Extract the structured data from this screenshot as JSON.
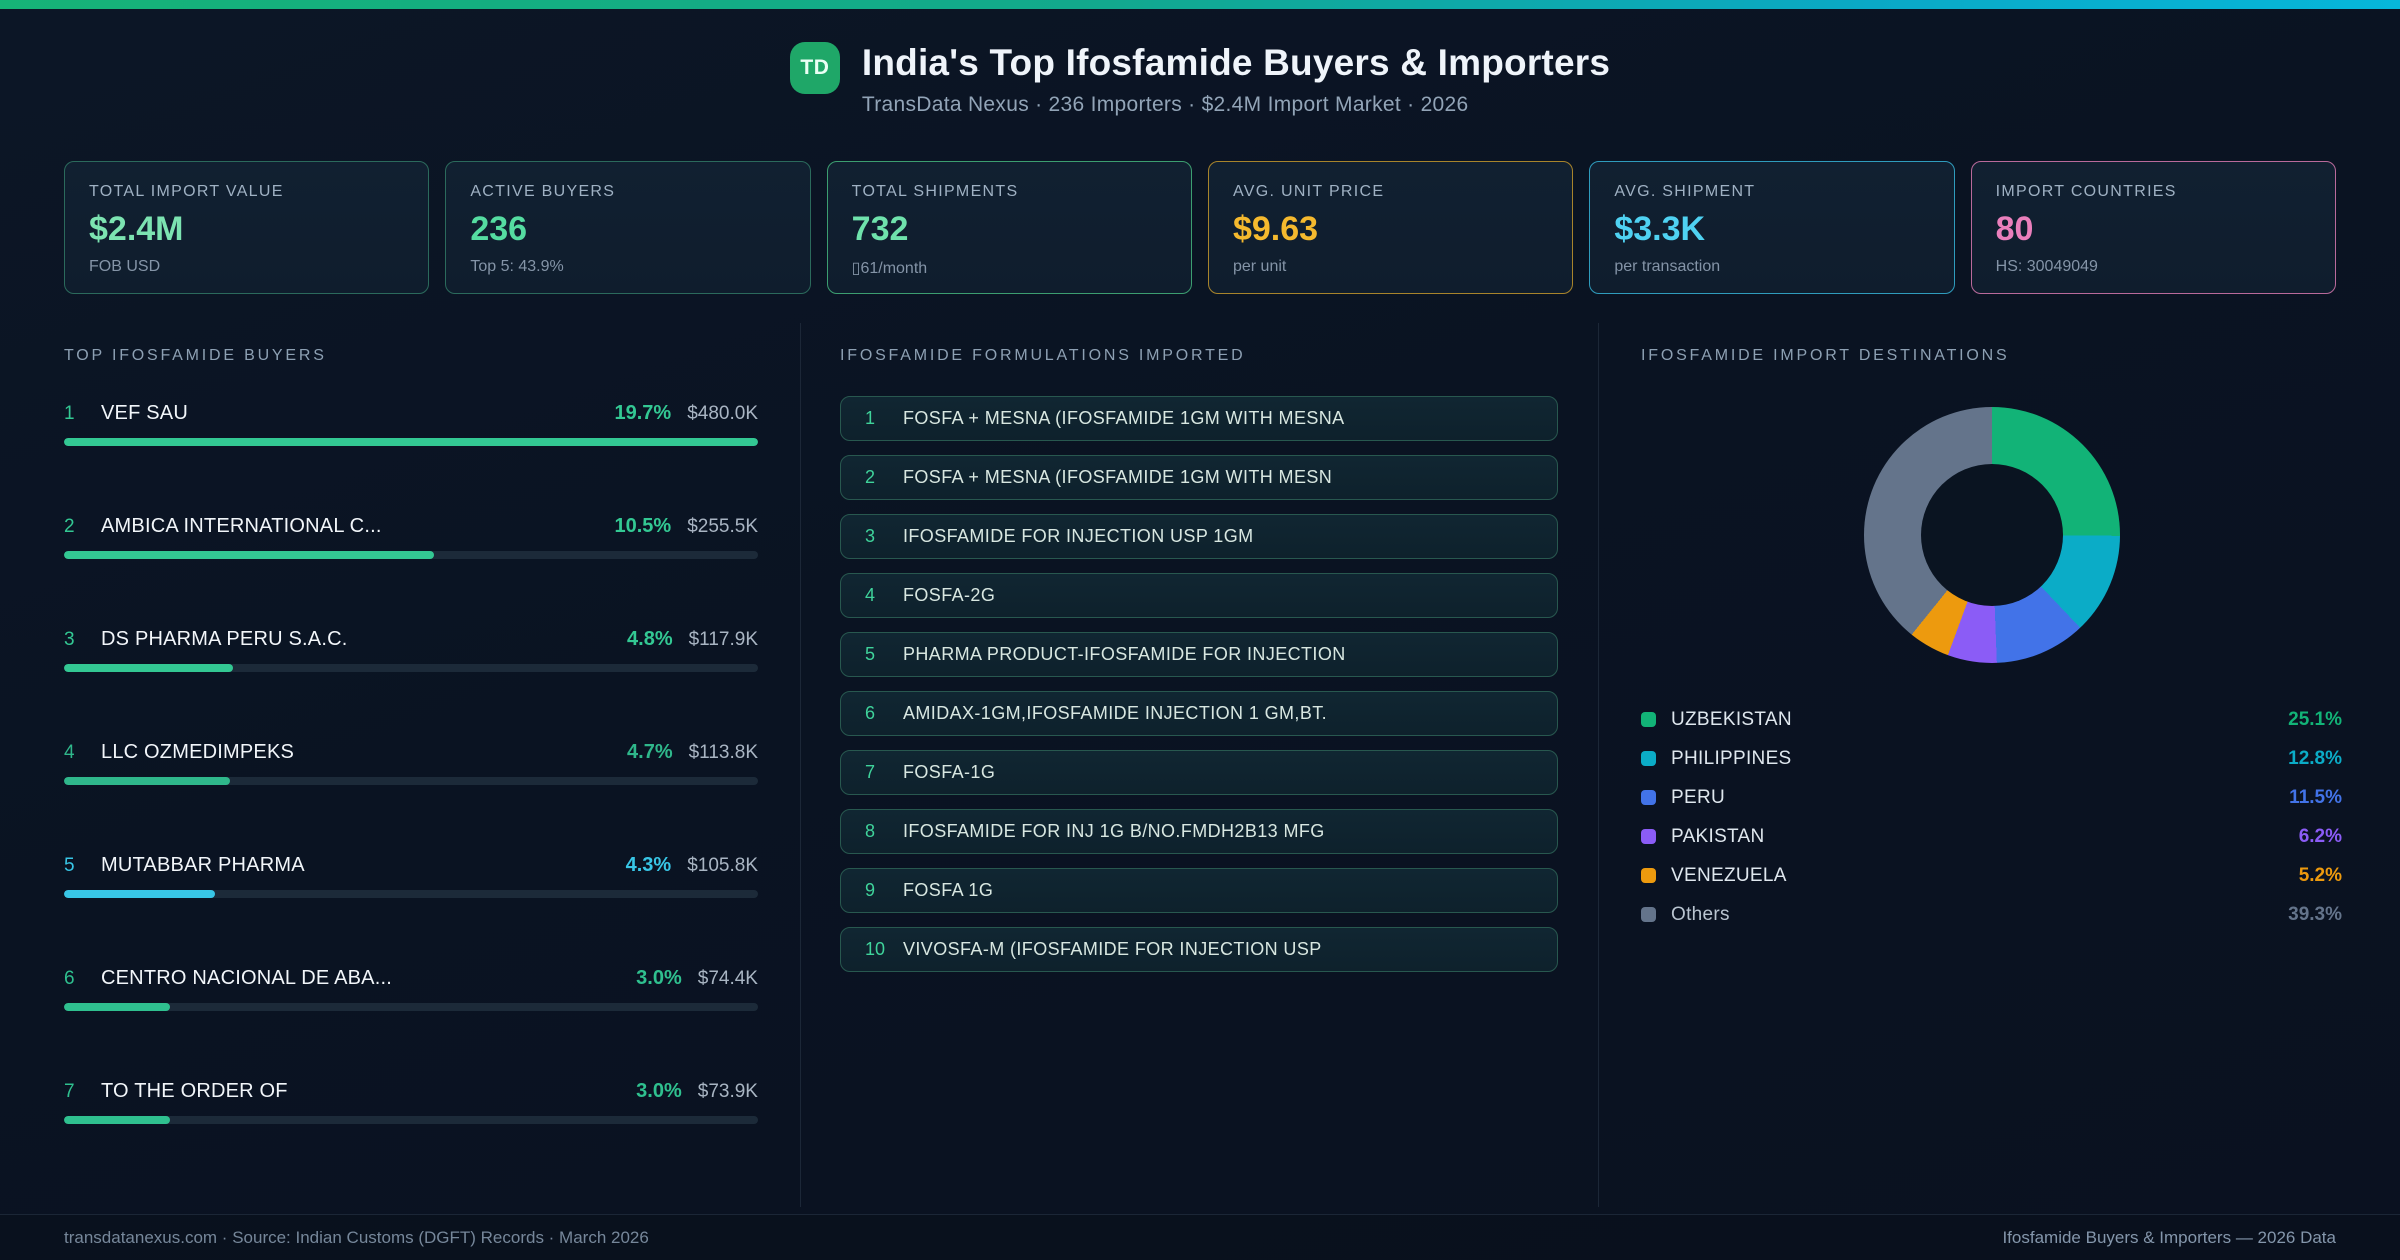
{
  "header": {
    "badge": "TD",
    "title": "India's Top Ifosfamide Buyers & Importers",
    "subtitle": "TransData Nexus · 236 Importers · $2.4M Import Market · 2026"
  },
  "stats": {
    "cards": [
      {
        "label": "TOTAL IMPORT VALUE",
        "value": "$2.4M",
        "sub": "FOB USD",
        "border_color": "#2b6a5c",
        "value_color": "#7ce3b1"
      },
      {
        "label": "ACTIVE BUYERS",
        "value": "236",
        "sub": "Top 5: 43.9%",
        "border_color": "#2b6a5c",
        "value_color": "#55dca1"
      },
      {
        "label": "TOTAL SHIPMENTS",
        "value": "732",
        "sub": "▯61/month",
        "border_color": "#3c9e70",
        "value_color": "#6fe2ac"
      },
      {
        "label": "AVG. UNIT PRICE",
        "value": "$9.63",
        "sub": "per unit",
        "border_color": "#a8842b",
        "value_color": "#f5b92e"
      },
      {
        "label": "AVG. SHIPMENT",
        "value": "$3.3K",
        "sub": "per transaction",
        "border_color": "#2f9cbd",
        "value_color": "#4fd2f2"
      },
      {
        "label": "IMPORT COUNTRIES",
        "value": "80",
        "sub": "HS: 30049049",
        "border_color": "#b96a9b",
        "value_color": "#ea7fbc"
      }
    ]
  },
  "buyers": {
    "title": "TOP IFOSFAMIDE BUYERS",
    "rows": [
      {
        "rank": "1",
        "name": "VEF SAU",
        "pct": "19.7%",
        "share": 19.7,
        "value": "$480.0K",
        "color": "#33c893"
      },
      {
        "rank": "2",
        "name": "AMBICA INTERNATIONAL C...",
        "pct": "10.5%",
        "share": 10.5,
        "value": "$255.5K",
        "color": "#33c893"
      },
      {
        "rank": "3",
        "name": "DS PHARMA PERU S.A.C.",
        "pct": "4.8%",
        "share": 4.8,
        "value": "$117.9K",
        "color": "#33c893"
      },
      {
        "rank": "4",
        "name": "LLC OZMEDIMPEKS",
        "pct": "4.7%",
        "share": 4.7,
        "value": "$113.8K",
        "color": "#2fb78b"
      },
      {
        "rank": "5",
        "name": "MUTABBAR PHARMA",
        "pct": "4.3%",
        "share": 4.3,
        "value": "$105.8K",
        "color": "#38c6e6"
      },
      {
        "rank": "6",
        "name": "CENTRO NACIONAL DE ABA...",
        "pct": "3.0%",
        "share": 3.0,
        "value": "$74.4K",
        "color": "#2fc08f"
      },
      {
        "rank": "7",
        "name": "TO THE ORDER OF",
        "pct": "3.0%",
        "share": 3.0,
        "value": "$73.9K",
        "color": "#2fc08f"
      }
    ]
  },
  "formulations": {
    "title": "IFOSFAMIDE FORMULATIONS IMPORTED",
    "items": [
      {
        "num": "1",
        "text": "FOSFA + MESNA (IFOSFAMIDE 1GM WITH MESNA"
      },
      {
        "num": "2",
        "text": "FOSFA + MESNA (IFOSFAMIDE 1GM WITH MESN"
      },
      {
        "num": "3",
        "text": "IFOSFAMIDE FOR INJECTION USP 1GM"
      },
      {
        "num": "4",
        "text": "FOSFA-2G"
      },
      {
        "num": "5",
        "text": "PHARMA PRODUCT-IFOSFAMIDE FOR INJECTION"
      },
      {
        "num": "6",
        "text": "AMIDAX-1GM,IFOSFAMIDE INJECTION 1 GM,BT."
      },
      {
        "num": "7",
        "text": "FOSFA-1G"
      },
      {
        "num": "8",
        "text": "IFOSFAMIDE FOR INJ 1G B/NO.FMDH2B13 MFG"
      },
      {
        "num": "9",
        "text": "FOSFA 1G"
      },
      {
        "num": "10",
        "text": "VIVOSFA-M (IFOSFAMIDE FOR INJECTION USP"
      }
    ]
  },
  "destinations": {
    "title": "IFOSFAMIDE IMPORT DESTINATIONS"
  },
  "chart_data": [
    {
      "type": "pie",
      "subtype": "donut",
      "title": "IFOSFAMIDE IMPORT DESTINATIONS",
      "start_angle_deg": 0,
      "direction": "clockwise",
      "inner_radius_ratio": 0.55,
      "legend_position": "below",
      "segments": [
        {
          "label": "UZBEKISTAN",
          "value": 25.1,
          "display": "25.1%",
          "color": "#12b377"
        },
        {
          "label": "PHILIPPINES",
          "value": 12.8,
          "display": "12.8%",
          "color": "#0bacc7"
        },
        {
          "label": "PERU",
          "value": 11.5,
          "display": "11.5%",
          "color": "#4273e8"
        },
        {
          "label": "PAKISTAN",
          "value": 6.2,
          "display": "6.2%",
          "color": "#8b5cf6"
        },
        {
          "label": "VENEZUELA",
          "value": 5.2,
          "display": "5.2%",
          "color": "#ed9a0e"
        },
        {
          "label": "Others",
          "value": 39.3,
          "display": "39.3%",
          "color": "#64748b"
        }
      ]
    },
    {
      "type": "bar",
      "title": "TOP IFOSFAMIDE BUYERS",
      "orientation": "horizontal",
      "categories": [
        "VEF SAU",
        "AMBICA INTERNATIONAL C...",
        "DS PHARMA PERU S.A.C.",
        "LLC OZMEDIMPEKS",
        "MUTABBAR PHARMA",
        "CENTRO NACIONAL DE ABA...",
        "TO THE ORDER OF"
      ],
      "values": [
        19.7,
        10.5,
        4.8,
        4.7,
        4.3,
        3.0,
        3.0
      ],
      "unit": "%",
      "value_labels": [
        "$480.0K",
        "$255.5K",
        "$117.9K",
        "$113.8K",
        "$105.8K",
        "$74.4K",
        "$73.9K"
      ],
      "xlim": [
        0,
        19.7
      ]
    }
  ],
  "footer": {
    "left": "transdatanexus.com · Source: Indian Customs (DGFT) Records · March 2026",
    "right": "Ifosfamide Buyers & Importers — 2026 Data"
  }
}
